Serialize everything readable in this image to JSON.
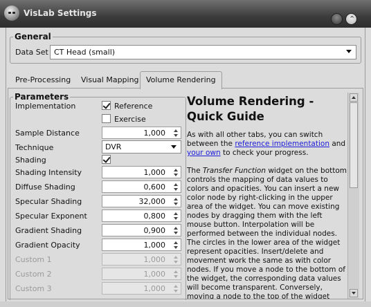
{
  "window": {
    "title": "VisLab Settings",
    "close_glyph": "⌃"
  },
  "general": {
    "legend": "General",
    "dataset_label": "Data Set",
    "dataset_value": "CT Head (small)"
  },
  "tabs": [
    {
      "label": "Pre-Processing",
      "active": false
    },
    {
      "label": "Visual Mapping",
      "active": false
    },
    {
      "label": "Volume Rendering",
      "active": true
    }
  ],
  "parameters": {
    "legend": "Parameters",
    "implementation_label": "Implementation",
    "reference_label": "Reference",
    "reference_checked": true,
    "exercise_label": "Exercise",
    "exercise_checked": false,
    "sample_distance_label": "Sample Distance",
    "sample_distance_value": "1,000",
    "technique_label": "Technique",
    "technique_value": "DVR",
    "shading_label": "Shading",
    "shading_checked": true,
    "shading_intensity_label": "Shading Intensity",
    "shading_intensity_value": "1,000",
    "diffuse_shading_label": "Diffuse Shading",
    "diffuse_shading_value": "0,600",
    "specular_shading_label": "Specular Shading",
    "specular_shading_value": "32,000",
    "specular_exponent_label": "Specular Exponent",
    "specular_exponent_value": "0,800",
    "gradient_shading_label": "Gradient Shading",
    "gradient_shading_value": "0,900",
    "gradient_opacity_label": "Gradient Opacity",
    "gradient_opacity_value": "1,000",
    "custom1_label": "Custom 1",
    "custom1_value": "1,000",
    "custom2_label": "Custom 2",
    "custom2_value": "1,000",
    "custom3_label": "Custom 3",
    "custom3_value": "1,000"
  },
  "help": {
    "title": "Volume Rendering - Quick Guide",
    "p1_a": "As with all other tabs, you can switch between the ",
    "p1_link1": "reference implementation",
    "p1_b": " and ",
    "p1_link2": "your own",
    "p1_c": " to check your progress.",
    "p2_a": "The ",
    "p2_em": "Transfer Function",
    "p2_b": " widget on the bottom controls the mapping of data values to colors and opacities. You can insert a new color node by right-clicking in the upper area of the widget. You can move existing nodes by dragging them with the left mouse button. Interpolation will be performed between the individual nodes. The circles in the lower area of the widget represent opacities. Insert/delete and movement work the same as with color nodes. If you move a node to the bottom of the widget, the corresponding data values will become transparent. Conversely, moving a node to the top of the widget makes it"
  }
}
